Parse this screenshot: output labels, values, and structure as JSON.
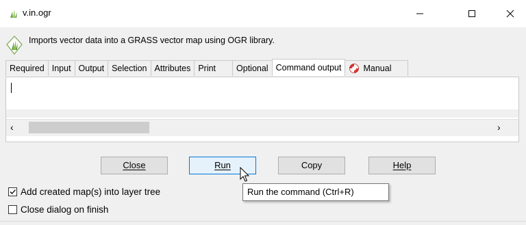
{
  "window": {
    "title": "v.in.ogr"
  },
  "description": "Imports vector data into a GRASS vector map using OGR library.",
  "tabs": [
    {
      "label": "Required",
      "active": false
    },
    {
      "label": "Input",
      "active": false
    },
    {
      "label": "Output",
      "active": false
    },
    {
      "label": "Selection",
      "active": false
    },
    {
      "label": "Attributes",
      "active": false
    },
    {
      "label": "Print",
      "active": false
    },
    {
      "label": "Optional",
      "active": false
    },
    {
      "label": "Command output",
      "active": true
    },
    {
      "label": "Manual",
      "active": false,
      "icon": "lifebuoy-icon"
    }
  ],
  "output": {
    "text": ""
  },
  "buttons": {
    "close": "Close",
    "run": "Run",
    "copy": "Copy",
    "help": "Help"
  },
  "tooltip": "Run the command (Ctrl+R)",
  "checkboxes": [
    {
      "label": "Add created map(s) into layer tree",
      "checked": true
    },
    {
      "label": "Close dialog on finish",
      "checked": false
    }
  ],
  "colors": {
    "accent": "#0078d7",
    "lifebuoy_red": "#e0352b"
  }
}
